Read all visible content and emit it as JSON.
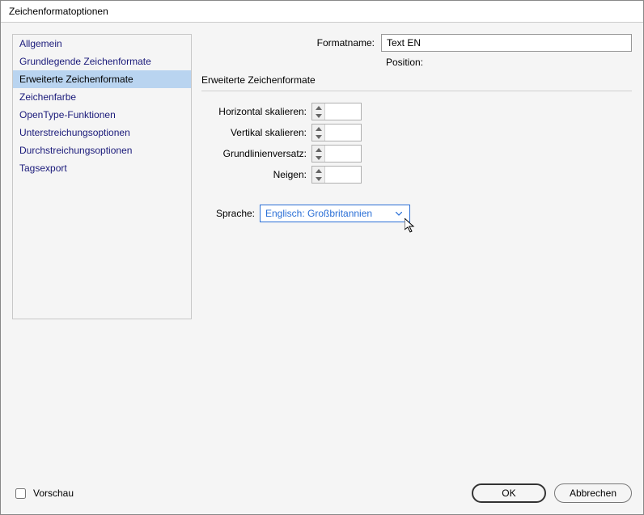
{
  "dialog": {
    "title": "Zeichenformatoptionen"
  },
  "sidebar": {
    "items": [
      {
        "label": "Allgemein"
      },
      {
        "label": "Grundlegende Zeichenformate"
      },
      {
        "label": "Erweiterte Zeichenformate"
      },
      {
        "label": "Zeichenfarbe"
      },
      {
        "label": "OpenType-Funktionen"
      },
      {
        "label": "Unterstreichungsoptionen"
      },
      {
        "label": "Durchstreichungsoptionen"
      },
      {
        "label": "Tagsexport"
      }
    ],
    "selected_index": 2
  },
  "header": {
    "formatname_label": "Formatname:",
    "formatname_value": "Text EN",
    "position_label": "Position:"
  },
  "section": {
    "title": "Erweiterte Zeichenformate"
  },
  "fields": {
    "horizontal_label": "Horizontal skalieren:",
    "horizontal_value": "",
    "vertical_label": "Vertikal skalieren:",
    "vertical_value": "",
    "baseline_label": "Grundlinienversatz:",
    "baseline_value": "",
    "skew_label": "Neigen:",
    "skew_value": ""
  },
  "language": {
    "label": "Sprache:",
    "value": "Englisch: Großbritannien"
  },
  "footer": {
    "preview_label": "Vorschau",
    "preview_checked": false,
    "ok_label": "OK",
    "cancel_label": "Abbrechen"
  }
}
